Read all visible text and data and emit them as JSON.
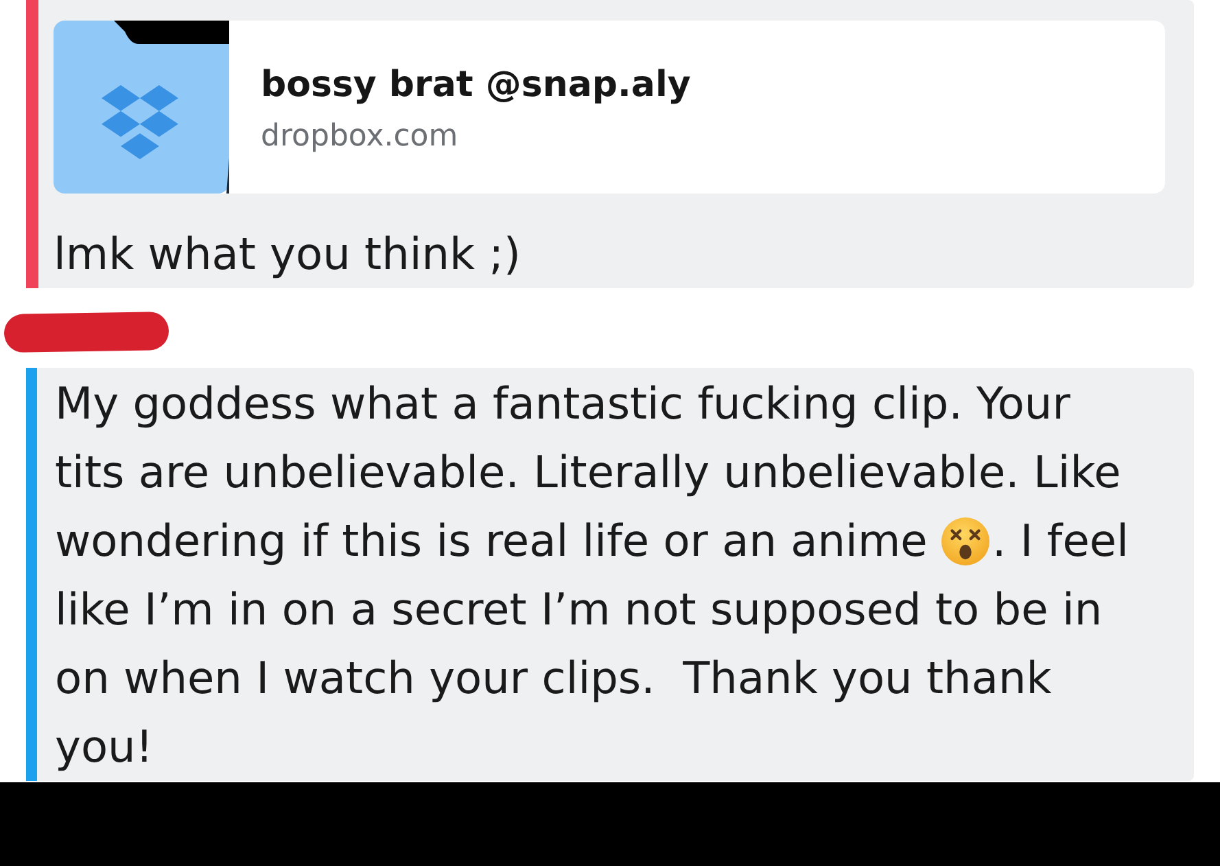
{
  "messages": [
    {
      "color": "#f0435a",
      "sender_redacted": false,
      "link": {
        "title": "bossy brat @snap.aly",
        "domain": "dropbox.com"
      },
      "body": [
        {
          "kind": "text",
          "text": "lmk what you think ;)"
        }
      ]
    },
    {
      "color": "#1ba1ee",
      "sender_redacted": true,
      "body": [
        {
          "kind": "text",
          "text": "My goddess what a fantastic fucking clip. Your\ntits are unbelievable. Literally unbelievable. Like\nwondering if this is real life or an anime "
        },
        {
          "kind": "emoji"
        },
        {
          "kind": "text",
          "text": ". I feel\nlike I’m in on a secret I’m not supposed to be in\non when I watch your clips.  Thank you thank\nyou!"
        }
      ]
    }
  ]
}
